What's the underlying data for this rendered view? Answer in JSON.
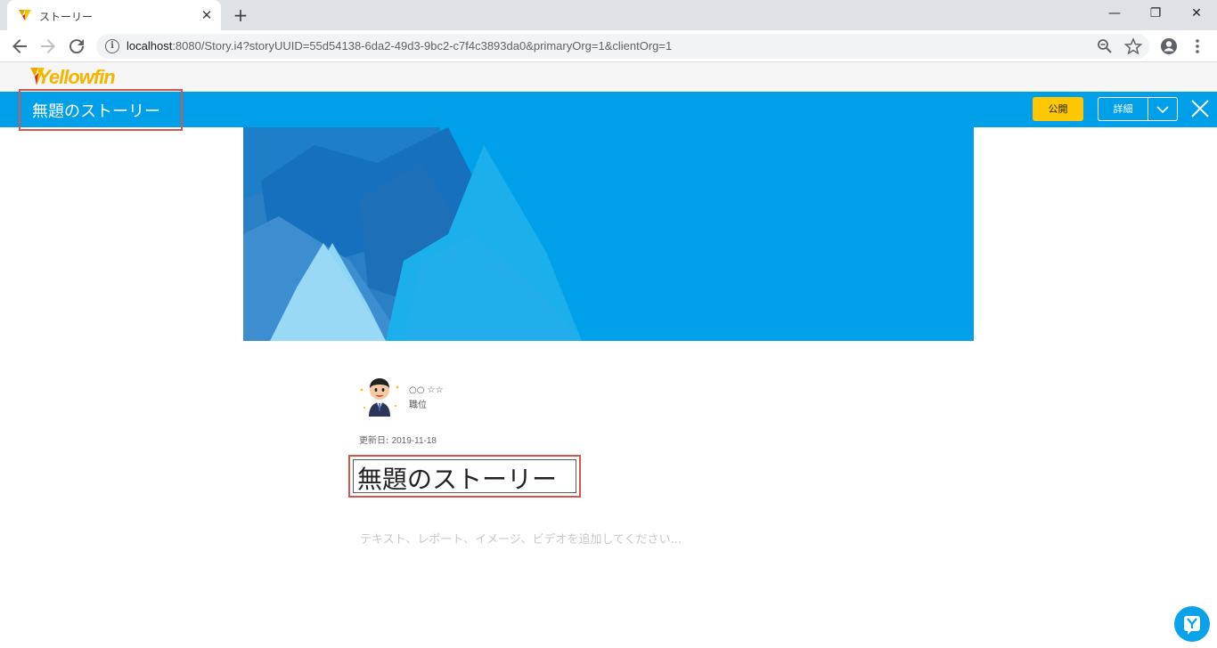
{
  "browser": {
    "tab_title": "ストーリー",
    "tab_close": "✕",
    "new_tab": "+",
    "url_host": "localhost",
    "url_rest": ":8080/Story.i4?storyUUID=55d54138-6da2-49d3-9bc2-c7f4c3893da0&primaryOrg=1&clientOrg=1",
    "window_controls": {
      "minimize": "—",
      "restore": "❐",
      "close": "✕"
    }
  },
  "app": {
    "logo_text": "Yellowfin",
    "story_title": "無題のストーリー",
    "publish_label": "公開",
    "detail_label": "詳細"
  },
  "story": {
    "author_name": "○○ ☆☆",
    "author_role": "職位",
    "updated_label": "更新日: ",
    "updated_date": "2019-11-18",
    "title": "無題のストーリー",
    "body_placeholder": "テキスト、レポート、イメージ、ビデオを追加してください..."
  },
  "colors": {
    "brand_blue": "#009fe9",
    "publish_yellow": "#ffc700",
    "highlight_red": "#d9534f"
  },
  "icons": [
    "yellowfin-favicon",
    "back-arrow-icon",
    "forward-arrow-icon",
    "reload-icon",
    "info-icon",
    "zoom-out-icon",
    "star-icon",
    "account-icon",
    "menu-dots-icon",
    "chevron-down-icon",
    "close-icon",
    "help-chat-icon"
  ]
}
